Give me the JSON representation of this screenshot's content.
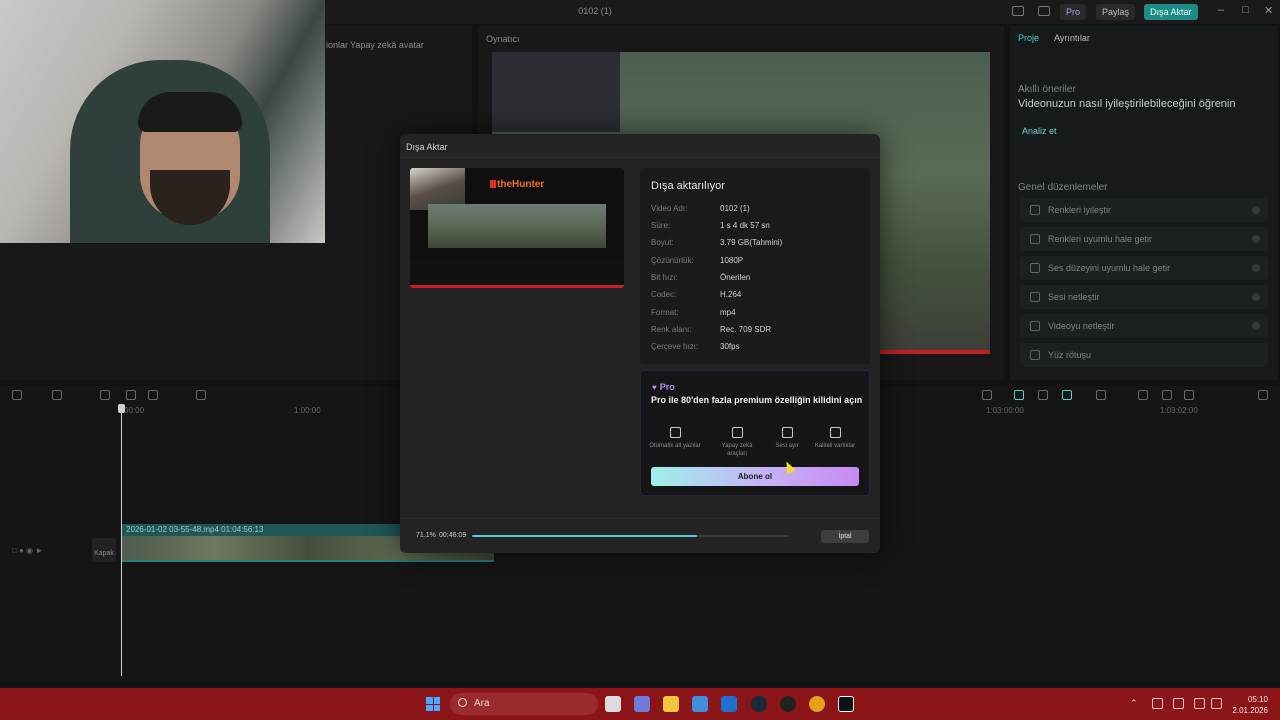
{
  "topbar": {
    "window_title": "0102 (1)",
    "pro_label": "Pro",
    "share_label": "Paylaş",
    "export_label": "Dışa Aktar"
  },
  "left_panel": {
    "tab_captions": "Yapay zekâ avatar",
    "tab_captions_partial": "ionlar"
  },
  "player": {
    "title": "Oynatıcı"
  },
  "right_panel": {
    "tab_project": "Proje",
    "tab_details": "Ayrıntılar",
    "smart_suggestions": "Akıllı öneriler",
    "smart_title": "Videonuzun nasıl iyileştirilebileceğini öğrenin",
    "analyze_label": "Analiz et",
    "general_edits": "Genel düzenlemeler",
    "items": [
      {
        "label": "Renkleri iyileştir"
      },
      {
        "label": "Renkleri uyumlu hale getir"
      },
      {
        "label": "Ses düzeyini uyumlu hale getir"
      },
      {
        "label": "Sesi netleştir"
      },
      {
        "label": "Videoyu netleştir"
      },
      {
        "label": "Yüz rötuşu"
      }
    ]
  },
  "timeline": {
    "clip_label": "2026-01-02 03-55-48.mp4   01:04:56:13",
    "cover_label": "Kapak",
    "time_marks": [
      "00:00",
      "1:00:00",
      "1:03:00:00",
      "1:03:02:00"
    ]
  },
  "dialog": {
    "title": "Dışa Aktar",
    "preview_brand": "theHunter",
    "status_title": "Dışa aktarılıyor",
    "rows": [
      {
        "key": "Video Adı:",
        "value": "0102 (1)"
      },
      {
        "key": "Süre:",
        "value": "1 s 4 dk 57 sn"
      },
      {
        "key": "Boyut:",
        "value": "3.79 GB(Tahmini)"
      },
      {
        "key": "Çözünürlük:",
        "value": "1080P"
      },
      {
        "key": "Bit hızı:",
        "value": "Önerilen"
      },
      {
        "key": "Codec:",
        "value": "H.264"
      },
      {
        "key": "Format:",
        "value": "mp4"
      },
      {
        "key": "Renk alanı:",
        "value": "Rec. 709 SDR"
      },
      {
        "key": "Çerçeve hızı:",
        "value": "30fps"
      }
    ],
    "pro": {
      "badge": "Pro",
      "title": "Pro ile 80'den fazla premium özelliğin kilidini açın",
      "features": [
        {
          "label": "Otomatik alt yazılar",
          "icon": "grid-icon"
        },
        {
          "label": "Yapay zekâ araçları",
          "icon": "magic-wand-icon"
        },
        {
          "label": "Sesi ayır",
          "icon": "audio-separate-icon"
        },
        {
          "label": "Kaliteli varlıklar",
          "icon": "image-assets-icon"
        }
      ],
      "subscribe_label": "Abone ol"
    },
    "progress": {
      "percent_text": "71.1%",
      "elapsed": "00:46:09",
      "fraction": 0.711
    },
    "cancel_label": "İptal"
  },
  "taskbar": {
    "search_label": "Ara",
    "time": "05:10",
    "date": "2.01.2026"
  },
  "colors": {
    "accent": "#4cd2c7",
    "taskbar": "#8a1418",
    "pro_purple": "#b98cf5"
  }
}
